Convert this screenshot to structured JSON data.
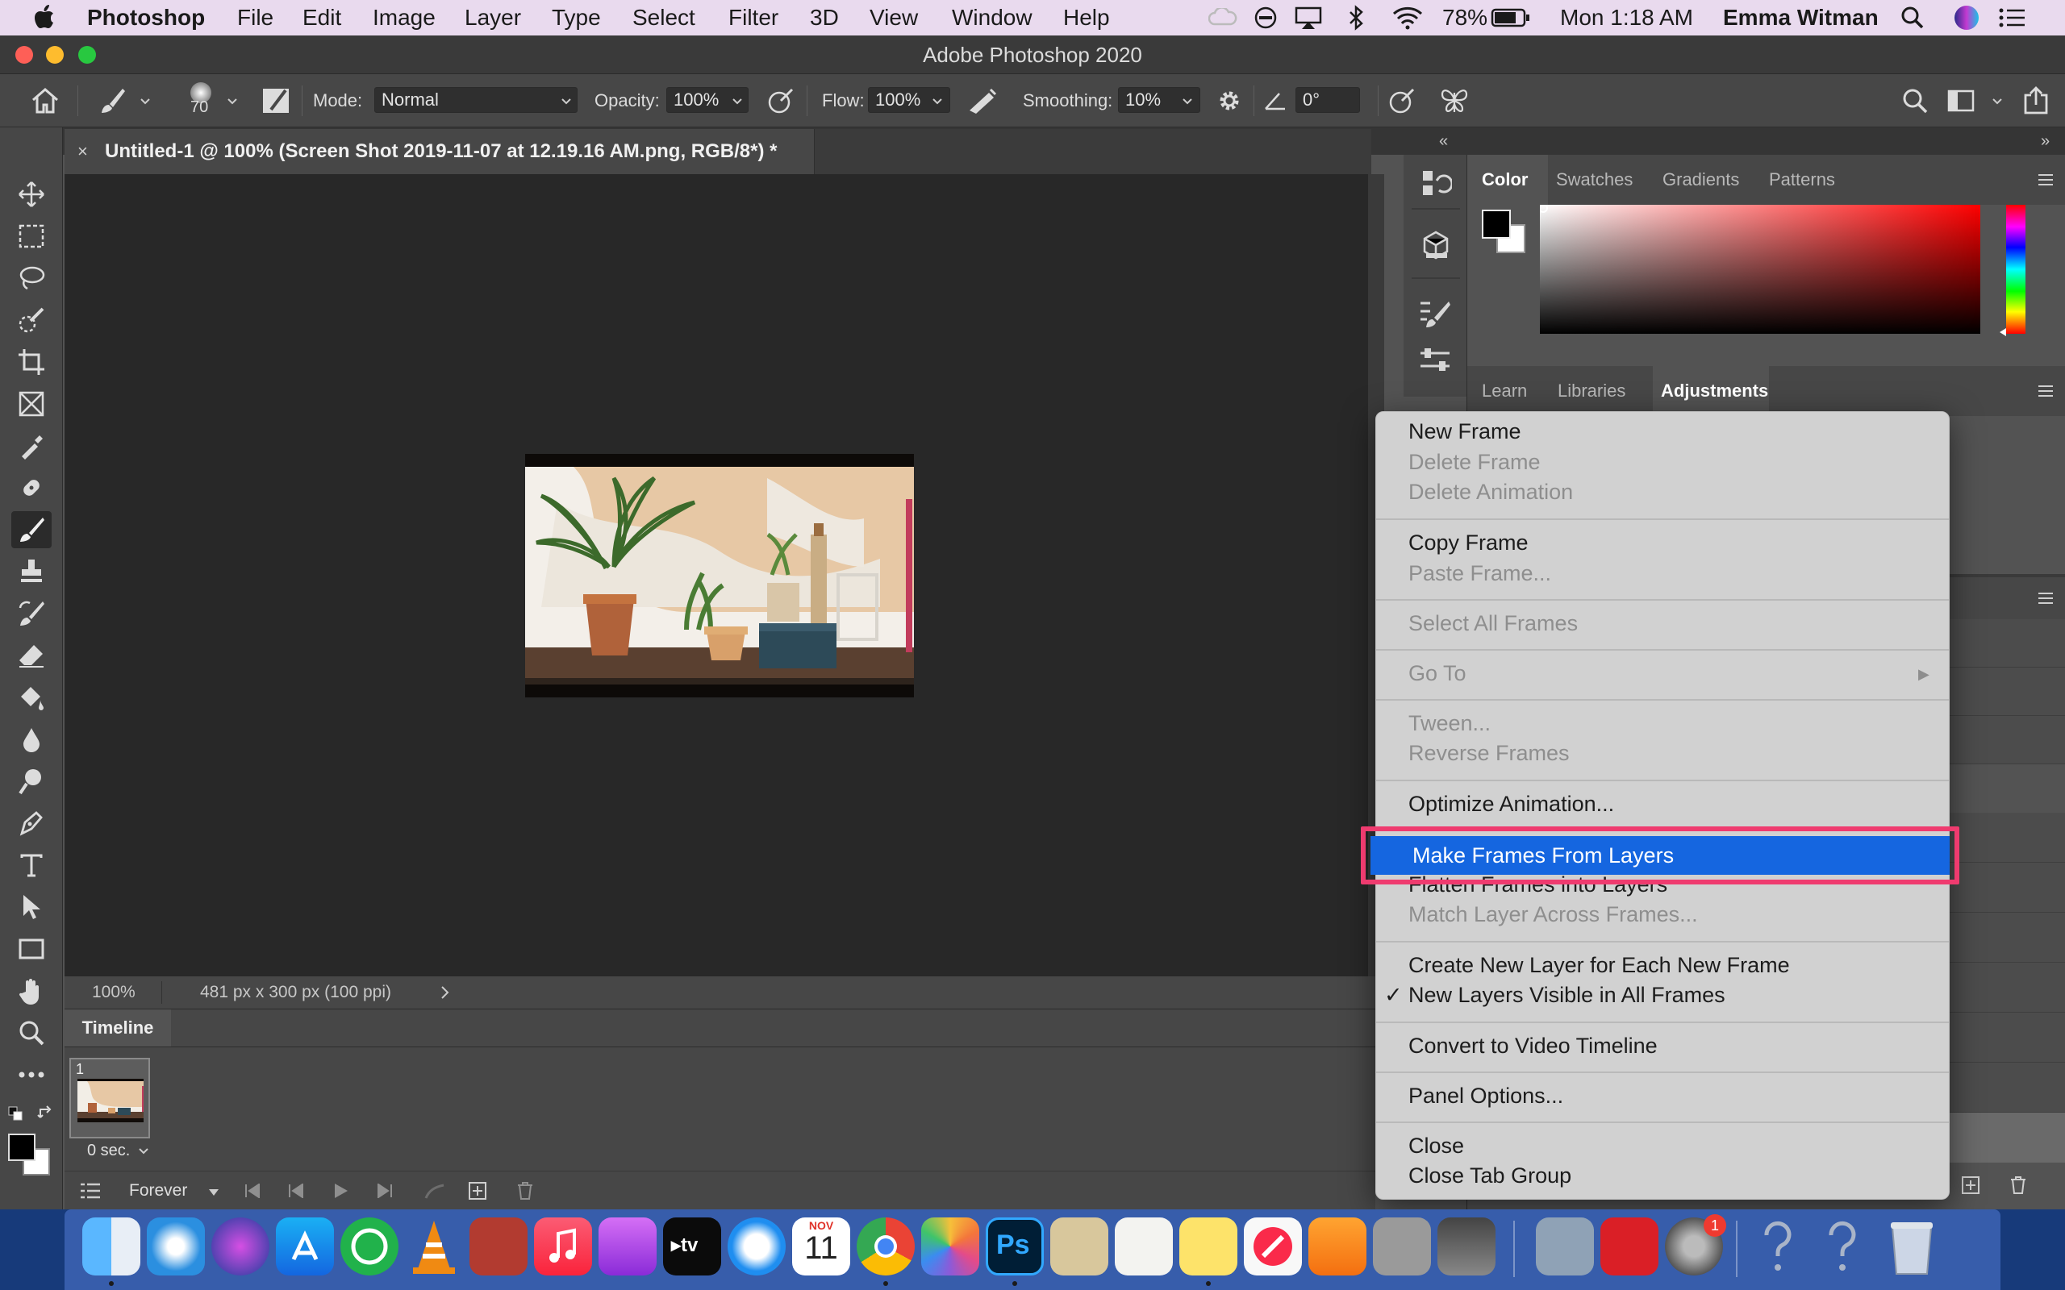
{
  "menubar": {
    "app_name": "Photoshop",
    "menus": [
      "File",
      "Edit",
      "Image",
      "Layer",
      "Type",
      "Select",
      "Filter",
      "3D",
      "View",
      "Window",
      "Help"
    ],
    "battery": "78%",
    "clock": "Mon 1:18 AM",
    "user": "Emma Witman"
  },
  "window": {
    "title": "Adobe Photoshop 2020"
  },
  "options": {
    "brush_size": "70",
    "mode_label": "Mode:",
    "mode_value": "Normal",
    "opacity_label": "Opacity:",
    "opacity_value": "100%",
    "flow_label": "Flow:",
    "flow_value": "100%",
    "smoothing_label": "Smoothing:",
    "smoothing_value": "10%",
    "angle_value": "0°"
  },
  "document": {
    "tab_title": "Untitled-1 @ 100% (Screen Shot 2019-11-07 at 12.19.16 AM.png, RGB/8*) *",
    "zoom": "100%",
    "doc_info": "481 px x 300 px (100 ppi)"
  },
  "timeline": {
    "tab": "Timeline",
    "frame_number": "1",
    "frame_delay": "0 sec.",
    "loop": "Forever"
  },
  "panels": {
    "color_tabs": [
      "Color",
      "Swatches",
      "Gradients",
      "Patterns"
    ],
    "lower_tabs": [
      "Learn",
      "Libraries",
      "Adjustments"
    ]
  },
  "context_menu": {
    "items": [
      "New Frame",
      "Delete Frame",
      "Delete Animation",
      "Copy Frame",
      "Paste Frame...",
      "Select All Frames",
      "Go To",
      "Tween...",
      "Reverse Frames",
      "Optimize Animation...",
      "Make Frames From Layers",
      "Flatten Frames into Layers",
      "Match Layer Across Frames...",
      "Create New Layer for Each New Frame",
      "New Layers Visible in All Frames",
      "Convert to Video Timeline",
      "Panel Options...",
      "Close",
      "Close Tab Group"
    ],
    "checkmark": "✓",
    "submenu_arrow": "▶"
  },
  "dock": {
    "calendar_month": "NOV",
    "calendar_day": "11",
    "cc_badge": "1",
    "ps_label": "Ps"
  },
  "colors": {
    "highlight": "#1566e0",
    "annotation": "#ef3b6f",
    "menu_bg": "#d1d1d1",
    "canvas_bg": "#282828",
    "ui_bg": "#535353"
  }
}
